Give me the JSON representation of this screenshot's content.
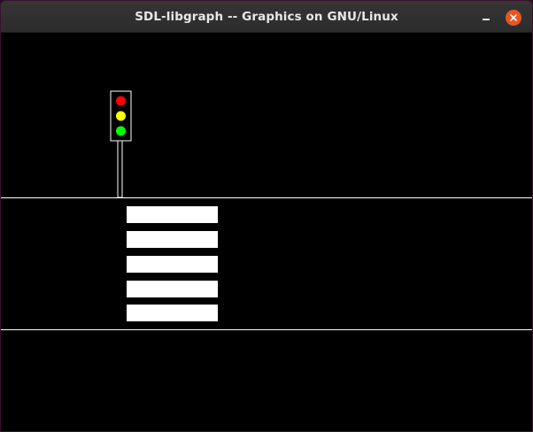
{
  "window": {
    "title": "SDL-libgraph -- Graphics on GNU/Linux",
    "controls": {
      "minimize_icon": "minimize-icon",
      "close_icon": "close-icon"
    }
  },
  "colors": {
    "canvas_background": "#000000",
    "road_lines": "#ffffff",
    "crosswalk_stripes": "#ffffff",
    "signal_red": "#ff0000",
    "signal_yellow": "#ffff00",
    "signal_green": "#00ff00",
    "close_button": "#e95420"
  },
  "scene": {
    "traffic_light_lamps": [
      "red",
      "yellow",
      "green"
    ],
    "crosswalk_stripe_count": 5
  }
}
